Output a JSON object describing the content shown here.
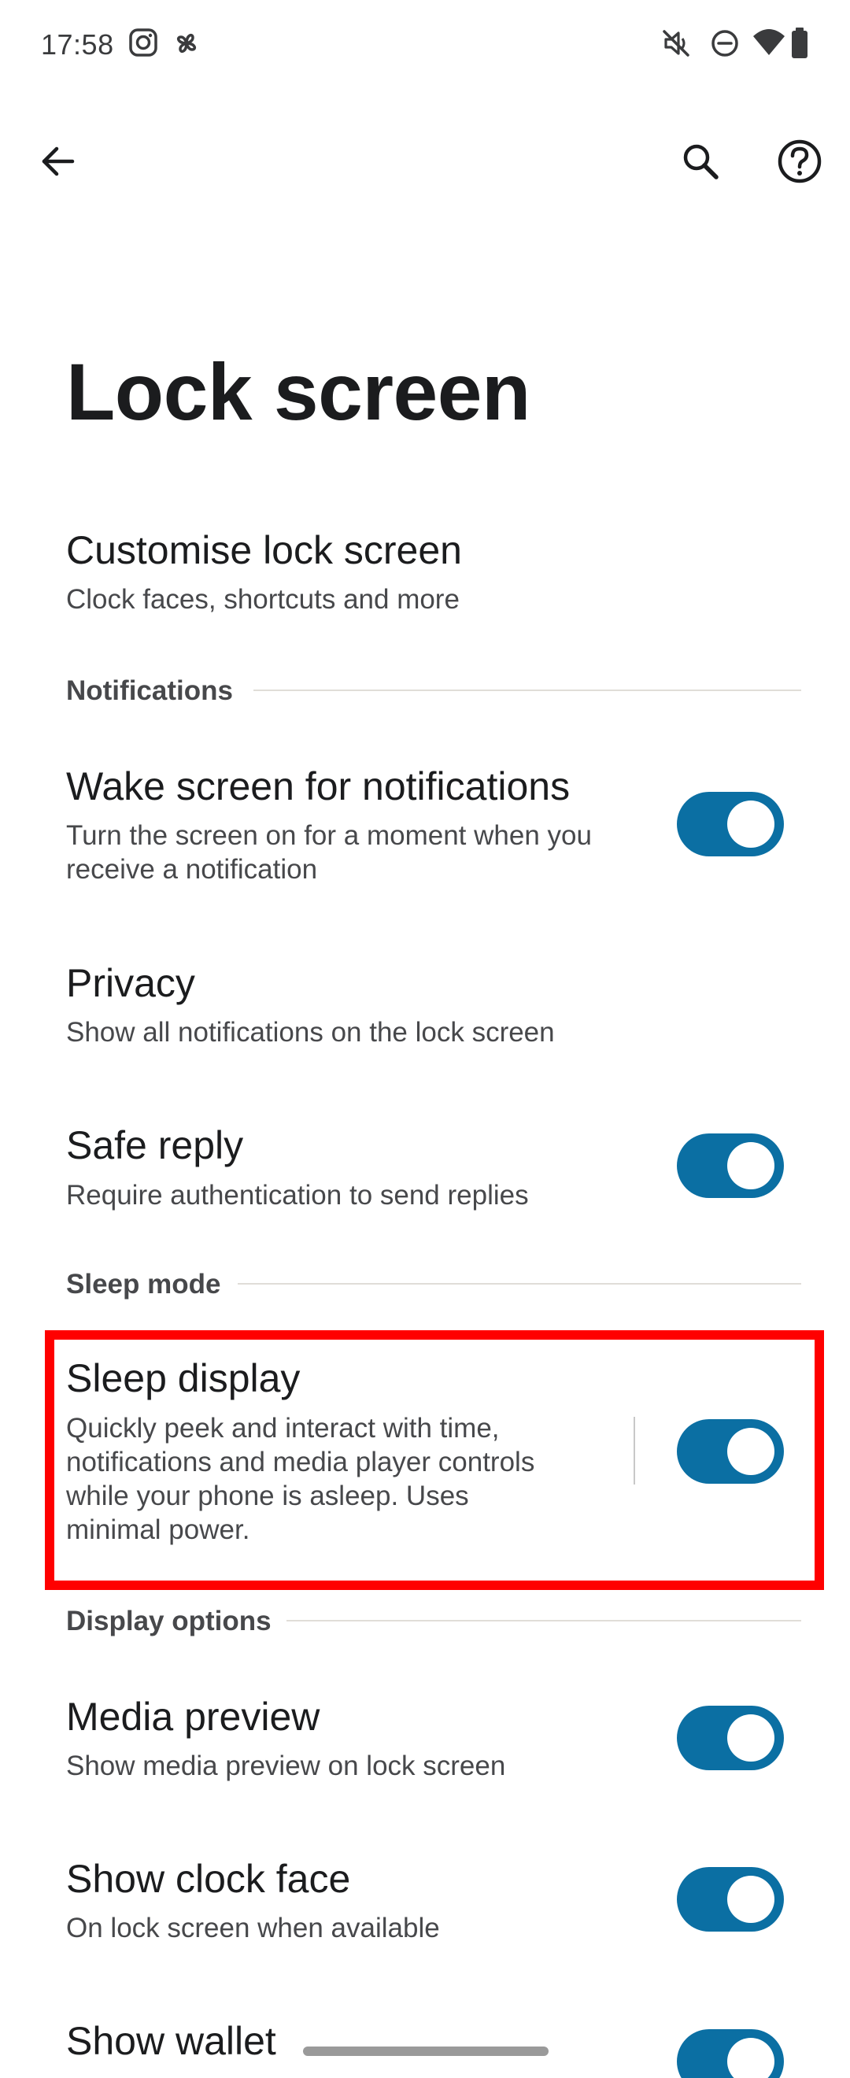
{
  "status_bar": {
    "time": "17:58",
    "left_icons": [
      "instagram-icon",
      "pinwheel-icon"
    ],
    "right_icons": [
      "mute-icon",
      "do-not-disturb-icon",
      "wifi-icon",
      "battery-icon"
    ]
  },
  "app_bar": {
    "back_icon": "arrow-back-icon",
    "search_icon": "search-icon",
    "help_icon": "help-icon"
  },
  "page": {
    "title": "Lock screen"
  },
  "customise": {
    "title": "Customise lock screen",
    "subtitle": "Clock faces, shortcuts and more"
  },
  "sections": {
    "notifications": "Notifications",
    "sleep_mode": "Sleep mode",
    "display_options": "Display options"
  },
  "items": {
    "wake_screen": {
      "title": "Wake screen for notifications",
      "subtitle": "Turn the screen on for a moment when you receive a notification",
      "enabled": true
    },
    "privacy": {
      "title": "Privacy",
      "subtitle": "Show all notifications on the lock screen"
    },
    "safe_reply": {
      "title": "Safe reply",
      "subtitle": "Require authentication to send replies",
      "enabled": true
    },
    "sleep_display": {
      "title": "Sleep display",
      "subtitle": "Quickly peek and interact with time, notifications and media player controls while your phone is asleep. Uses minimal power.",
      "enabled": true
    },
    "media_preview": {
      "title": "Media preview",
      "subtitle": "Show media preview on lock screen",
      "enabled": true
    },
    "show_clock_face": {
      "title": "Show clock face",
      "subtitle": "On lock screen when available",
      "enabled": true
    },
    "show_wallet": {
      "title": "Show wallet",
      "enabled": true
    }
  },
  "colors": {
    "toggle_on": "#0b6fa3",
    "highlight": "#ff0000",
    "title_text": "#1b1c1e",
    "secondary_text": "#47484b"
  }
}
